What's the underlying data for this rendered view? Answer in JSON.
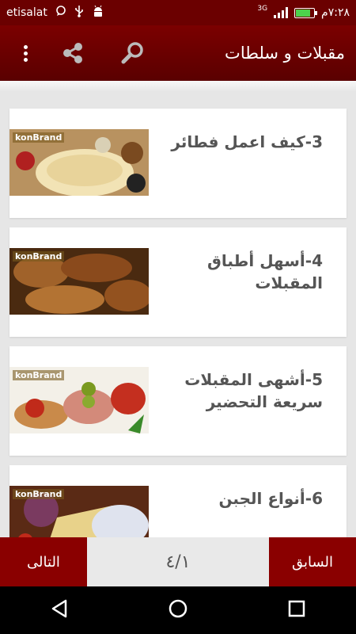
{
  "status_bar": {
    "carrier": "etisalat",
    "network": "3G",
    "time": "٧:٢٨م",
    "battery_level": 0.75
  },
  "app_bar": {
    "title": "مقبلات و سلطات"
  },
  "icons": {
    "more": "more-vert-icon",
    "share": "share-icon",
    "search": "search-icon"
  },
  "cards": [
    {
      "title": "3-كيف اعمل فطائر",
      "brand": "konBrand"
    },
    {
      "title": "4-أسهل أطباق المقبلات",
      "brand": "konBrand"
    },
    {
      "title": "5-أشهى المقبلات سريعة التحضير",
      "brand": "konBrand"
    },
    {
      "title": "6-أنواع الجبن",
      "brand": "konBrand"
    }
  ],
  "bottom_bar": {
    "next_label": "التالى",
    "page_indicator": "٤/١",
    "prev_label": "السابق"
  },
  "colors": {
    "primary": "#7b0000",
    "accent": "#8a0000"
  }
}
